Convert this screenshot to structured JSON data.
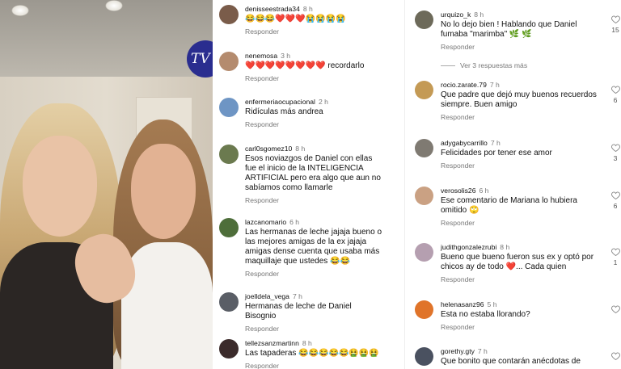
{
  "video": {
    "logo_text": "TV"
  },
  "middle_comments": [
    {
      "username": "denisseestrada34",
      "time": "8 h",
      "text": "😂😂😂❤️❤️❤️😭😭😭😭",
      "reply": "Responder",
      "avatar": "#7a5c4a"
    },
    {
      "username": "nenemosa",
      "time": "3 h",
      "text": "❤️❤️❤️❤️❤️❤️❤️❤️ recordarlo",
      "reply": "Responder",
      "avatar": "#b48b6e"
    },
    {
      "username": "enfermeriaocupacional",
      "time": "2 h",
      "text": "Ridículas más andrea",
      "reply": "Responder",
      "avatar": "#6e95c4"
    },
    {
      "username": "carl0sgomez10",
      "time": "8 h",
      "text": "Esos noviazgos de Daniel con ellas fue el inicio de la INTELIGENCIA ARTIFICIAL pero era algo que aun no sabíamos como llamarle",
      "reply": "Responder",
      "avatar": "#6b7a4f"
    },
    {
      "username": "lazcanomario",
      "time": "6 h",
      "text": "Las hermanas de leche jajaja bueno o las mejores amigas de la ex jajaja amigas dense cuenta que usaba más maquillaje que ustedes 😂😂",
      "reply": "Responder",
      "avatar": "#4e6e3a"
    },
    {
      "username": "joelldela_vega",
      "time": "7 h",
      "text": "Hermanas de leche de Daniel Bisognio",
      "reply": "Responder",
      "avatar": "#5a5e66"
    },
    {
      "username": "tellezsanzmartinn",
      "time": "8 h",
      "text": "Las tapaderas 😂😂😂😂😂🤮🤮🤮",
      "reply": "Responder",
      "avatar": "#3b2b2b"
    }
  ],
  "right_comments": [
    {
      "username": "urquizo_k",
      "time": "8 h",
      "text": "No lo dejo bien ! Hablando que Daniel fumaba \"marimba\" 🌿 🌿",
      "reply": "Responder",
      "likes": "15",
      "avatar": "#6d6a5a"
    },
    {
      "username": "rocio.zarate.79",
      "time": "7 h",
      "text": "Que padre que dejó muy buenos recuerdos siempre. Buen amigo",
      "reply": "Responder",
      "likes": "6",
      "avatar": "#c49a55"
    },
    {
      "username": "adygabycarrillo",
      "time": "7 h",
      "text": "Felicidades por tener ese amor",
      "reply": "Responder",
      "likes": "3",
      "avatar": "#7f7a72"
    },
    {
      "username": "verosolis26",
      "time": "6 h",
      "text": "Ese comentario de Mariana lo hubiera omitido 🙄",
      "reply": "Responder",
      "likes": "6",
      "avatar": "#caa183"
    },
    {
      "username": "judithgonzalezrubi",
      "time": "8 h",
      "text": "Bueno que bueno fueron sus ex y optó por chicos ay de todo ❤️... Cada quien",
      "reply": "Responder",
      "likes": "1",
      "avatar": "#b59fb0"
    },
    {
      "username": "helenasanz96",
      "time": "5 h",
      "text": "Esta no estaba llorando?",
      "reply": "Responder",
      "likes": "",
      "avatar": "#e0742a"
    },
    {
      "username": "gorethy.gty",
      "time": "7 h",
      "text": "Que bonito que contarán anécdotas de",
      "reply": "",
      "likes": "",
      "avatar": "#4a5160"
    }
  ],
  "more_replies": "Ver 3 respuestas más"
}
